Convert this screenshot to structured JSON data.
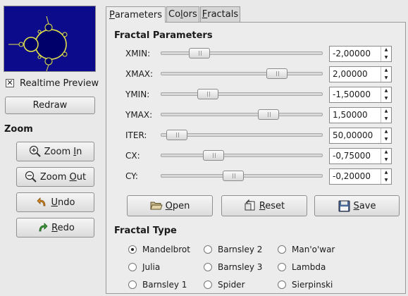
{
  "preview": {
    "realtime_label": "Realtime Preview",
    "realtime_checked": "✕"
  },
  "buttons": {
    "redraw": "Redraw",
    "zoom_in": {
      "pre": "Zoom ",
      "u": "I",
      "post": "n"
    },
    "zoom_out": {
      "pre": "Zoom ",
      "u": "O",
      "post": "ut"
    },
    "undo": {
      "pre": "",
      "u": "U",
      "post": "ndo"
    },
    "redo": {
      "pre": "",
      "u": "R",
      "post": "edo"
    }
  },
  "zoom_title": "Zoom",
  "tabs": [
    {
      "u": "P",
      "rest": "arameters"
    },
    {
      "pre": "Co",
      "u": "l",
      "rest": "ors"
    },
    {
      "u": "F",
      "rest": "ractals"
    }
  ],
  "fractal_parameters_title": "Fractal Parameters",
  "params": [
    {
      "label": "XMIN:",
      "value": "-2,00000",
      "fraction": 0.2
    },
    {
      "label": "XMAX:",
      "value": "2,00000",
      "fraction": 0.75
    },
    {
      "label": "YMIN:",
      "value": "-1,50000",
      "fraction": 0.26
    },
    {
      "label": "YMAX:",
      "value": "1,50000",
      "fraction": 0.69
    },
    {
      "label": "ITER:",
      "value": "50,00000",
      "fraction": 0.04
    },
    {
      "label": "CX:",
      "value": "-0,75000",
      "fraction": 0.3
    },
    {
      "label": "CY:",
      "value": "-0,20000",
      "fraction": 0.44
    }
  ],
  "actions": {
    "open": {
      "u": "O",
      "rest": "pen"
    },
    "reset": {
      "u": "R",
      "rest": "eset"
    },
    "save": {
      "u": "S",
      "rest": "ave"
    }
  },
  "fractal_type_title": "Fractal Type",
  "fractal_types": [
    {
      "label": "Mandelbrot",
      "selected": true
    },
    {
      "label": "Barnsley 2",
      "selected": false
    },
    {
      "label": "Man'o'war",
      "selected": false
    },
    {
      "label": "Julia",
      "selected": false
    },
    {
      "label": "Barnsley 3",
      "selected": false
    },
    {
      "label": "Lambda",
      "selected": false
    },
    {
      "label": "Barnsley 1",
      "selected": false
    },
    {
      "label": "Spider",
      "selected": false
    },
    {
      "label": "Sierpinski",
      "selected": false
    }
  ],
  "colors": {
    "preview_bg": "#0b0b8c",
    "fractal_fill": "#00006a",
    "fractal_edge": "#f2f24a",
    "accent_green": "#2e8b2e",
    "accent_orange": "#d98a1c"
  }
}
